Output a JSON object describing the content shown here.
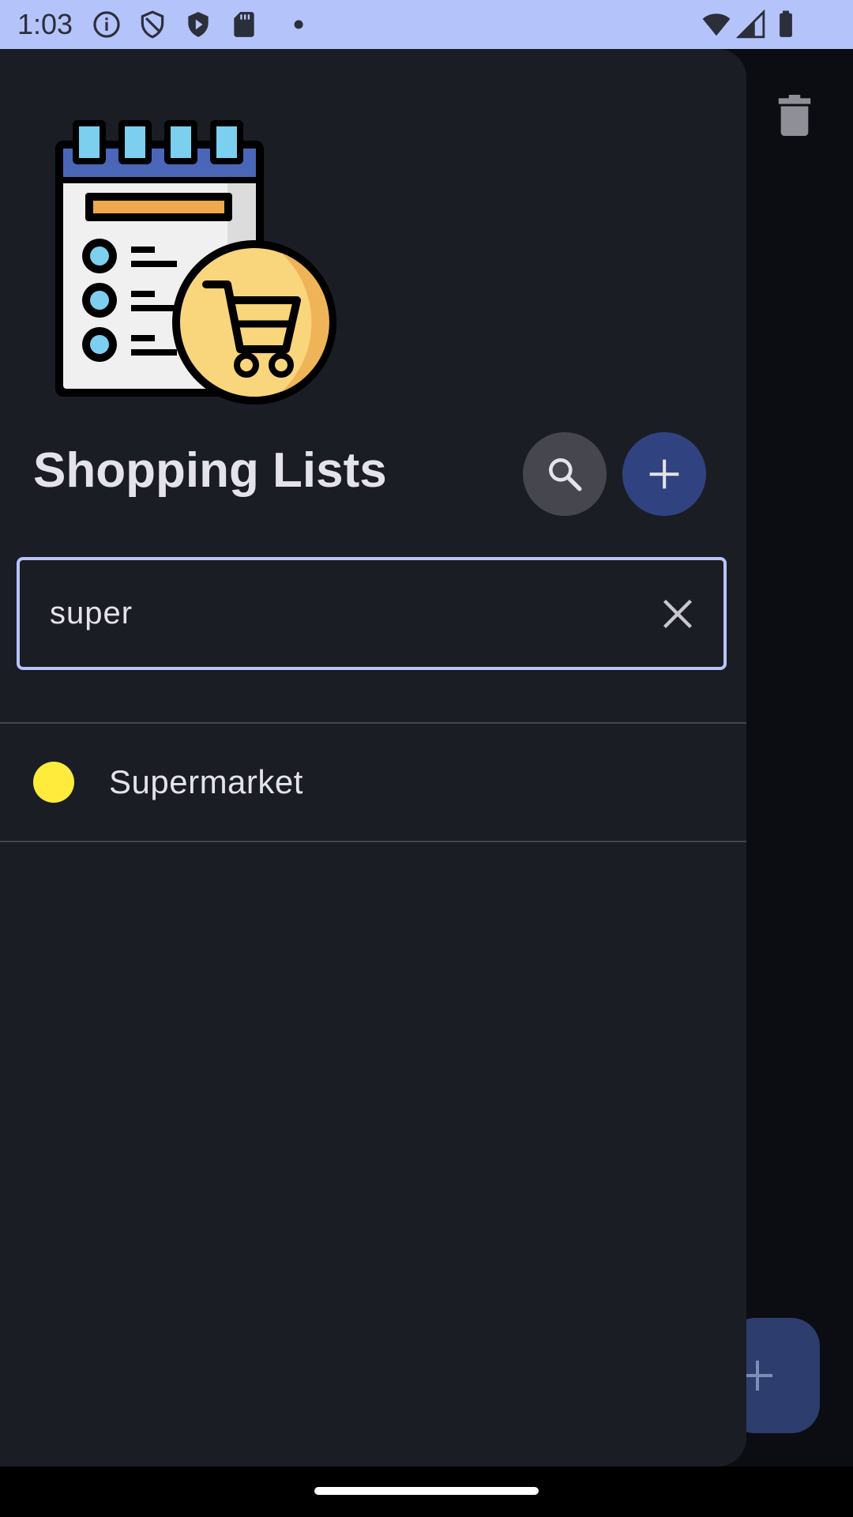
{
  "status_bar": {
    "time": "1:03",
    "left_icons": [
      "info-icon",
      "shield-icon",
      "play-shield-icon",
      "sd-card-icon",
      "dot-icon"
    ],
    "right_icons": [
      "wifi-icon",
      "signal-icon",
      "battery-icon"
    ],
    "background_color": "#b5c3fb"
  },
  "drawer": {
    "title": "Shopping Lists",
    "search_button_icon": "search-icon",
    "add_button_icon": "plus-icon",
    "search": {
      "value": "super",
      "clear_icon": "close-icon"
    },
    "lists": [
      {
        "name": "Supermarket",
        "color": "#ffeb3b"
      }
    ]
  },
  "background_app": {
    "delete_icon": "trash-icon",
    "fab_icon": "plus-icon"
  },
  "colors": {
    "drawer_bg": "#1b1d25",
    "accent": "#304380",
    "outline": "#b7c4fb"
  }
}
